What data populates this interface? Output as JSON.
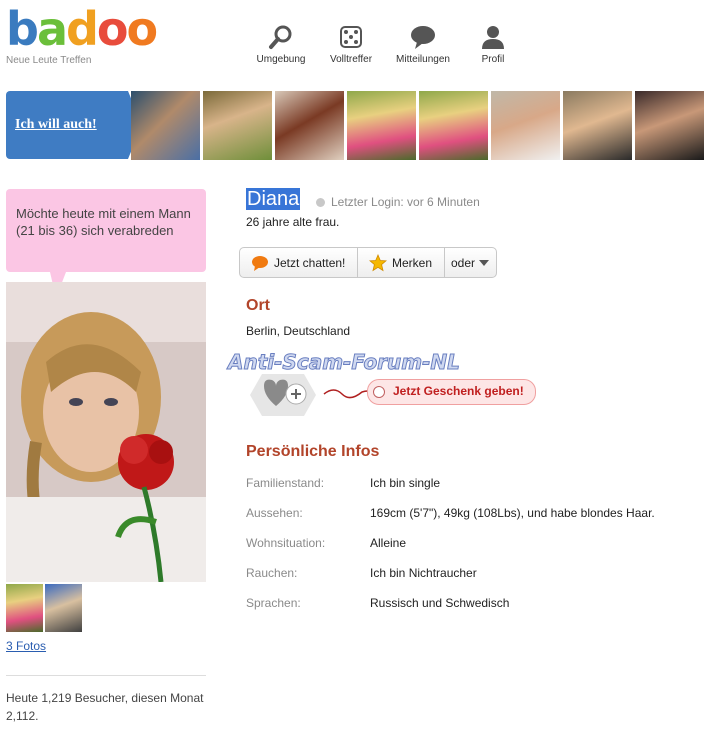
{
  "header": {
    "logo": {
      "b": "b",
      "a": "a",
      "d": "d",
      "o1": "o",
      "o2": "o"
    },
    "tagline": "Neue Leute Treffen",
    "nav": [
      {
        "label": "Umgebung",
        "icon": "search-icon"
      },
      {
        "label": "Volltreffer",
        "icon": "dice-icon"
      },
      {
        "label": "Mitteilungen",
        "icon": "speech-bubble-icon"
      },
      {
        "label": "Profil",
        "icon": "person-icon"
      }
    ]
  },
  "banner": {
    "cta": "Ich will auch!",
    "accent": "#3f7cc3"
  },
  "sidebar": {
    "bubble_text": "Möchte heute mit einem Mann (21 bis 36) sich verabreden",
    "photos_link": "3 Fotos",
    "visitors": "Heute 1,219 Besucher, diesen Monat 2,112."
  },
  "profile": {
    "name": "Diana",
    "last_login": "Letzter Login: vor 6 Minuten",
    "age": "26 jahre alte frau.",
    "actions": {
      "chat": "Jetzt chatten!",
      "bookmark": "Merken",
      "more": "oder"
    },
    "location_title": "Ort",
    "location": "Berlin, Deutschland",
    "watermark": "Anti-Scam-Forum-NL",
    "gift_button": "Jetzt Geschenk geben!",
    "info_title": "Persönliche Infos",
    "info": [
      {
        "label": "Familienstand:",
        "value": "Ich bin single"
      },
      {
        "label": "Aussehen:",
        "value": "169cm (5'7\"), 49kg (108Lbs), und habe blondes Haar."
      },
      {
        "label": "Wohnsituation:",
        "value": "Alleine"
      },
      {
        "label": "Rauchen:",
        "value": "Ich bin Nichtraucher"
      },
      {
        "label": "Sprachen:",
        "value": "Russisch und Schwedisch"
      }
    ],
    "title_color": "#b2442a"
  }
}
